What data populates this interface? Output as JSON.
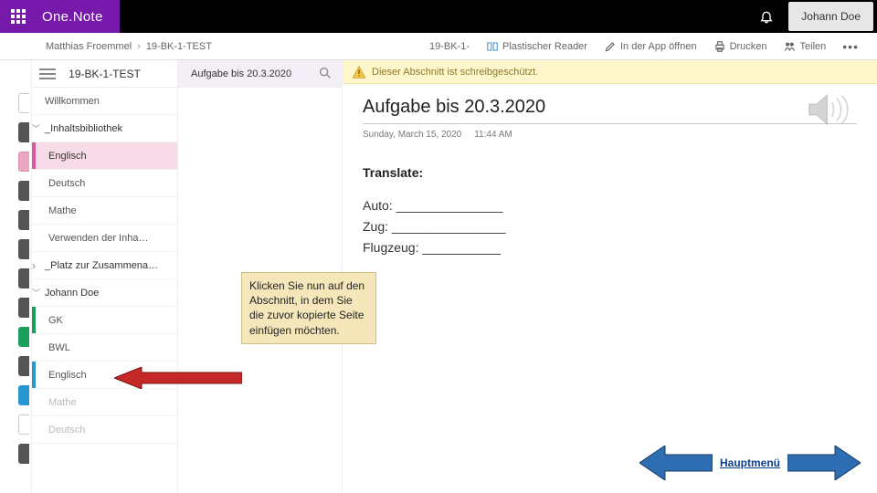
{
  "topbar": {
    "brand_one": "One",
    "brand_dot": ".",
    "brand_note": "Note",
    "user_name": "Johann Doe"
  },
  "cmdbar": {
    "crumb1": "Matthias Froemmel",
    "crumb2": "19-BK-1-TEST",
    "tab_title": "19-BK-1-",
    "reader": "Plastischer Reader",
    "open_in_app": "In der App öffnen",
    "print": "Drucken",
    "share": "Teilen"
  },
  "sidebar": {
    "notebook": "19-BK-1-TEST",
    "willkommen": "Willkommen",
    "inhaltsbib": "_Inhaltsbibliothek",
    "englisch": "Englisch",
    "deutsch": "Deutsch",
    "mathe": "Mathe",
    "verwenden": "Verwenden der Inha…",
    "platz": "_Platz zur Zusammena…",
    "johann": "Johann Doe",
    "gk": "GK",
    "bwl": "BWL",
    "englisch2": "Englisch",
    "mathe2": "Mathe",
    "deutsch2": "Deutsch"
  },
  "pages": {
    "current": "Aufgabe bis 20.3.2020"
  },
  "warning": {
    "text": "Dieser Abschnitt ist schreibgeschützt."
  },
  "page": {
    "title": "Aufgabe bis 20.3.2020",
    "date": "Sunday, March 15, 2020",
    "time": "11:44 AM",
    "translate": "Translate:",
    "line1": "Auto: _______________",
    "line2": "Zug: ________________",
    "line3": "Flugzeug: ___________"
  },
  "callout": {
    "text": "Klicken Sie nun auf den Abschnitt, in dem Sie die zuvor kopierte Seite einfügen möchten."
  },
  "nav": {
    "label": "Hauptmenü"
  }
}
